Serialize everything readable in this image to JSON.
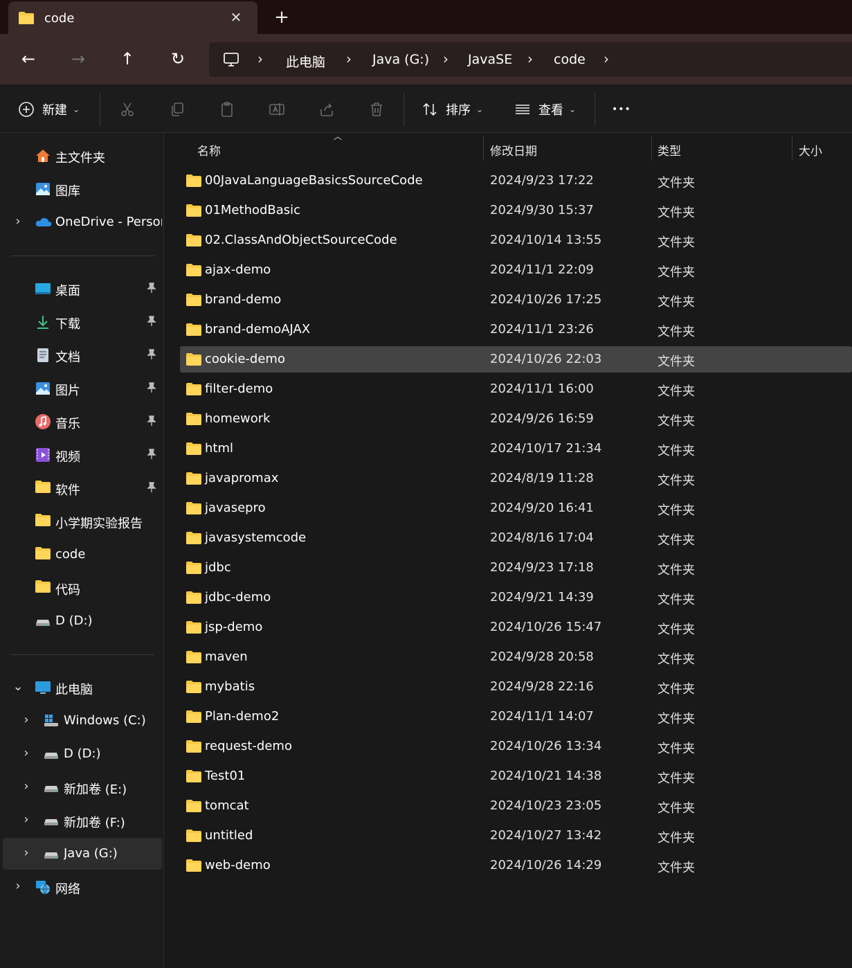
{
  "tab": {
    "title": "code",
    "close_glyph": "✕",
    "new_tab_glyph": "+"
  },
  "nav": {
    "back_glyph": "←",
    "forward_glyph": "→",
    "up_glyph": "↑",
    "refresh_glyph": "↻",
    "breadcrumbs": [
      "此电脑",
      "Java (G:)",
      "JavaSE",
      "code"
    ],
    "separator": "›"
  },
  "toolbar": {
    "new_label": "新建",
    "sort_label": "排序",
    "view_label": "查看",
    "more_glyph": "•••",
    "chevron": "⌄"
  },
  "sidebar": {
    "items": [
      {
        "label": "主文件夹",
        "icon": "home-icon"
      },
      {
        "label": "图库",
        "icon": "gallery-icon"
      },
      {
        "label": "OneDrive - Person",
        "icon": "onedrive-icon"
      },
      {
        "label": "桌面",
        "icon": "desktop-icon"
      },
      {
        "label": "下载",
        "icon": "download-icon"
      },
      {
        "label": "文档",
        "icon": "documents-icon"
      },
      {
        "label": "图片",
        "icon": "pictures-icon"
      },
      {
        "label": "音乐",
        "icon": "music-icon"
      },
      {
        "label": "视频",
        "icon": "videos-icon"
      },
      {
        "label": "软件",
        "icon": "folder-icon"
      },
      {
        "label": "小学期实验报告",
        "icon": "folder-icon"
      },
      {
        "label": "code",
        "icon": "folder-icon"
      },
      {
        "label": "代码",
        "icon": "folder-icon"
      },
      {
        "label": "D (D:)",
        "icon": "drive-icon"
      },
      {
        "label": "此电脑",
        "icon": "this-pc-icon"
      },
      {
        "label": "Windows  (C:)",
        "icon": "windows-drive-icon"
      },
      {
        "label": "D (D:)",
        "icon": "drive-icon"
      },
      {
        "label": "新加卷 (E:)",
        "icon": "drive-icon"
      },
      {
        "label": "新加卷 (F:)",
        "icon": "drive-icon"
      },
      {
        "label": "Java (G:)",
        "icon": "drive-icon"
      },
      {
        "label": "网络",
        "icon": "network-icon"
      }
    ],
    "pin_glyph": "📌",
    "expand_glyph": "›",
    "collapse_glyph": "⌄"
  },
  "columns": {
    "name": "名称",
    "modified": "修改日期",
    "type": "类型",
    "size": "大小"
  },
  "files": [
    {
      "name": "00JavaLanguageBasicsSourceCode",
      "date": "2024/9/23 17:22",
      "type": "文件夹"
    },
    {
      "name": "01MethodBasic",
      "date": "2024/9/30 15:37",
      "type": "文件夹"
    },
    {
      "name": "02.ClassAndObjectSourceCode",
      "date": "2024/10/14 13:55",
      "type": "文件夹"
    },
    {
      "name": "ajax-demo",
      "date": "2024/11/1 22:09",
      "type": "文件夹"
    },
    {
      "name": "brand-demo",
      "date": "2024/10/26 17:25",
      "type": "文件夹"
    },
    {
      "name": "brand-demoAJAX",
      "date": "2024/11/1 23:26",
      "type": "文件夹"
    },
    {
      "name": "cookie-demo",
      "date": "2024/10/26 22:03",
      "type": "文件夹"
    },
    {
      "name": "filter-demo",
      "date": "2024/11/1 16:00",
      "type": "文件夹"
    },
    {
      "name": "homework",
      "date": "2024/9/26 16:59",
      "type": "文件夹"
    },
    {
      "name": "html",
      "date": "2024/10/17 21:34",
      "type": "文件夹"
    },
    {
      "name": "javapromax",
      "date": "2024/8/19 11:28",
      "type": "文件夹"
    },
    {
      "name": "javasepro",
      "date": "2024/9/20 16:41",
      "type": "文件夹"
    },
    {
      "name": "javasystemcode",
      "date": "2024/8/16 17:04",
      "type": "文件夹"
    },
    {
      "name": "jdbc",
      "date": "2024/9/23 17:18",
      "type": "文件夹"
    },
    {
      "name": "jdbc-demo",
      "date": "2024/9/21 14:39",
      "type": "文件夹"
    },
    {
      "name": "jsp-demo",
      "date": "2024/10/26 15:47",
      "type": "文件夹"
    },
    {
      "name": "maven",
      "date": "2024/9/28 20:58",
      "type": "文件夹"
    },
    {
      "name": "mybatis",
      "date": "2024/9/28 22:16",
      "type": "文件夹"
    },
    {
      "name": "Plan-demo2",
      "date": "2024/11/1 14:07",
      "type": "文件夹"
    },
    {
      "name": "request-demo",
      "date": "2024/10/26 13:34",
      "type": "文件夹"
    },
    {
      "name": "Test01",
      "date": "2024/10/21 14:38",
      "type": "文件夹"
    },
    {
      "name": "tomcat",
      "date": "2024/10/23 23:05",
      "type": "文件夹"
    },
    {
      "name": "untitled",
      "date": "2024/10/27 13:42",
      "type": "文件夹"
    },
    {
      "name": "web-demo",
      "date": "2024/10/26 14:29",
      "type": "文件夹"
    }
  ],
  "selected_file": "cookie-demo",
  "selected_sidebar": "Java (G:)",
  "colors": {
    "folder": "#f6c844",
    "selection": "#444444",
    "accent": "#4cc2ff"
  }
}
